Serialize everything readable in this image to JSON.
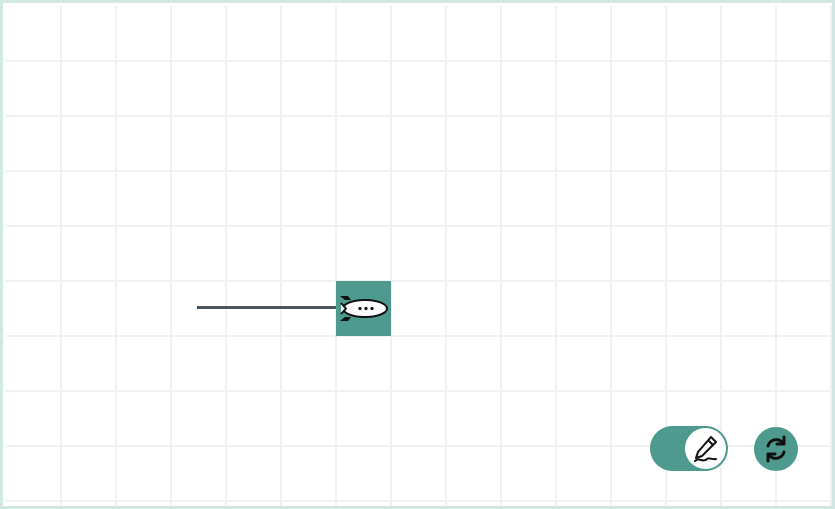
{
  "canvas": {
    "grid_color": "#eef3f1",
    "frame_color": "#d3e7e2",
    "trail_color": "#4a5560",
    "accent_color": "#4f9a8f"
  },
  "robot": {
    "icon": "rocket-icon",
    "direction": "right"
  },
  "controls": {
    "pen_toggle": {
      "icon": "pen-icon",
      "state": "on"
    },
    "reset_button": {
      "icon": "refresh-icon"
    }
  }
}
